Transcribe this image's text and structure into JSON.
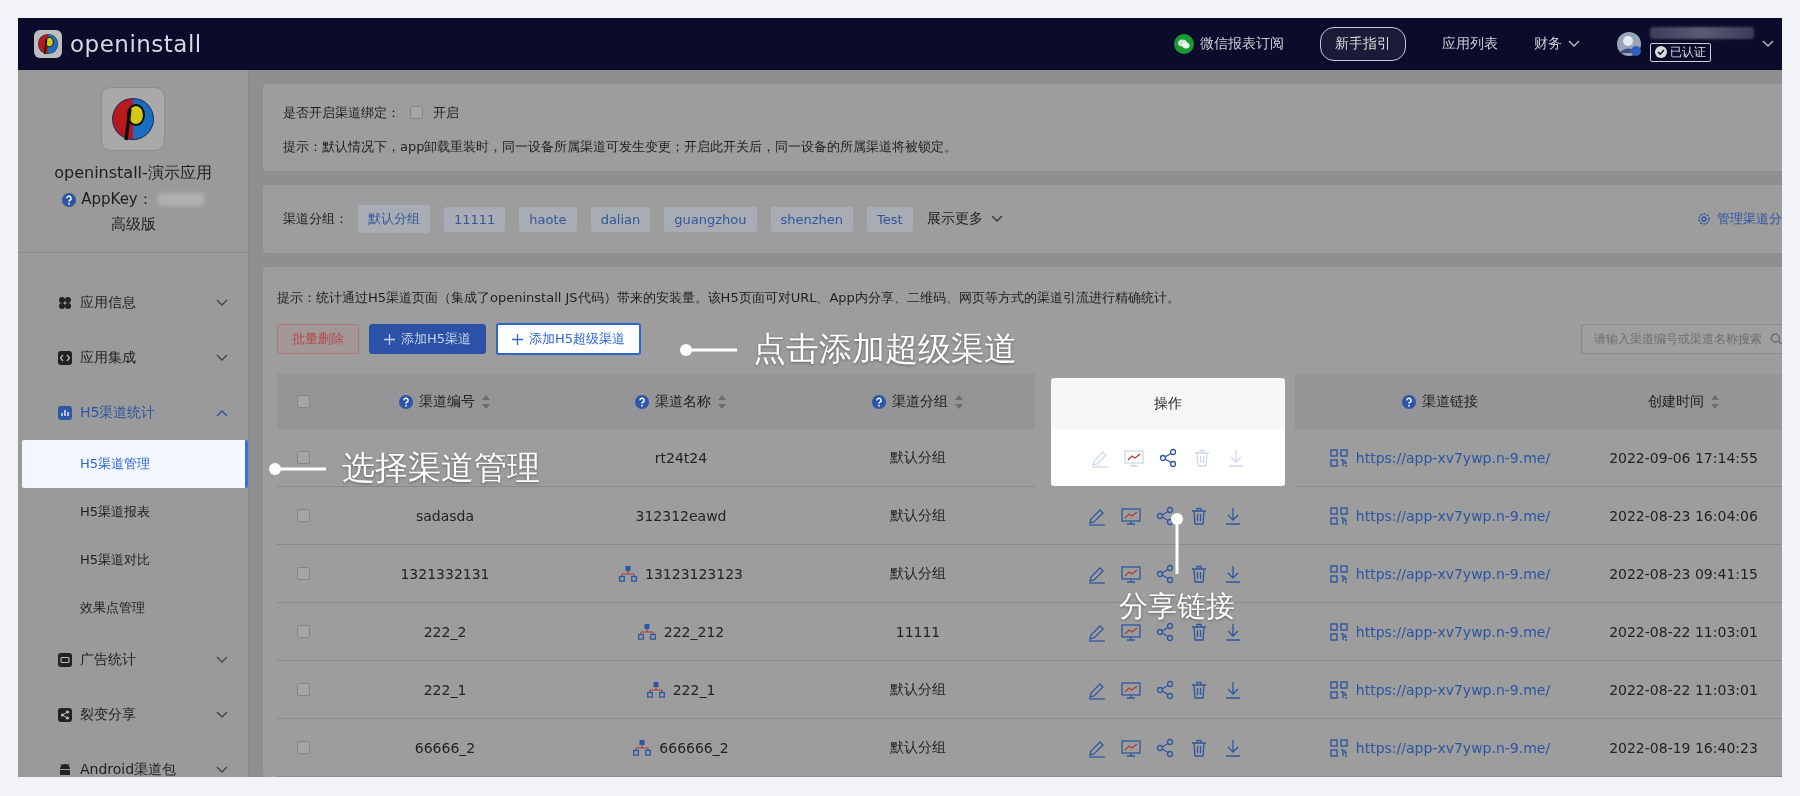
{
  "header": {
    "brand": "openinstall",
    "nav": [
      {
        "kind": "wechat",
        "label": "微信报表订阅"
      },
      {
        "kind": "guide",
        "label": "新手指引"
      },
      {
        "kind": "link",
        "label": "应用列表"
      },
      {
        "kind": "dropdown",
        "label": "财务"
      }
    ],
    "user": {
      "badge": "已认证"
    }
  },
  "sidebar": {
    "app_name": "openinstall-演示应用",
    "appkey_label": "AppKey：",
    "edition": "高级版",
    "menu": [
      {
        "label": "应用信息",
        "expanded": false
      },
      {
        "label": "应用集成",
        "expanded": false
      },
      {
        "label": "H5渠道统计",
        "expanded": true,
        "children": [
          {
            "label": "H5渠道管理",
            "selected": true
          },
          {
            "label": "H5渠道报表",
            "selected": false
          },
          {
            "label": "H5渠道对比",
            "selected": false
          },
          {
            "label": "效果点管理",
            "selected": false
          }
        ]
      },
      {
        "label": "广告统计",
        "expanded": false
      },
      {
        "label": "裂变分享",
        "expanded": false
      },
      {
        "label": "Android渠道包",
        "expanded": false
      }
    ]
  },
  "binding": {
    "label": "是否开启渠道绑定：",
    "checked": false,
    "option": "开启",
    "tip": "提示：默认情况下，app卸载重装时，同一设备所属渠道可发生变更；开启此开关后，同一设备的所属渠道将被锁定。"
  },
  "groups": {
    "label": "渠道分组：",
    "tags": [
      "默认分组",
      "11111",
      "haote",
      "dalian",
      "guangzhou",
      "shenzhen",
      "Test"
    ],
    "more": "展示更多",
    "manage": "管理渠道分"
  },
  "channels": {
    "tip": "提示：统计通过H5渠道页面（集成了openinstall JS代码）带来的安装量。该H5页面可对URL、App内分享、二维码、网页等方式的渠道引流进行精确统计。",
    "buttons": [
      {
        "kind": "danger",
        "label": "批量删除",
        "highlighted": false
      },
      {
        "kind": "primary",
        "label": "添加H5渠道",
        "highlighted": false
      },
      {
        "kind": "outline",
        "label": "添加H5超级渠道",
        "highlighted": true
      }
    ],
    "search": {
      "placeholder": "请输入渠道编号或渠道名称搜索"
    },
    "select_all": false,
    "columns": [
      {
        "kind": "text",
        "label": "渠道编号",
        "help": true,
        "sortable": true,
        "highlighted": false
      },
      {
        "kind": "name",
        "label": "渠道名称",
        "help": true,
        "sortable": true,
        "highlighted": false
      },
      {
        "kind": "text",
        "label": "渠道分组",
        "help": true,
        "sortable": true,
        "highlighted": false
      },
      {
        "kind": "actions",
        "label": "操作",
        "help": false,
        "sortable": false,
        "highlighted": true
      },
      {
        "kind": "link",
        "label": "渠道链接",
        "help": true,
        "sortable": false,
        "highlighted": false
      },
      {
        "kind": "text",
        "label": "创建时间",
        "help": false,
        "sortable": true,
        "highlighted": false
      }
    ],
    "rows": [
      {
        "checked": false,
        "highlighted": true,
        "super": false,
        "cells": [
          "",
          "rt24t24",
          "默认分组",
          "",
          "https://app-xv7ywp.n-9.me/",
          "2022-09-06 17:14:55"
        ]
      },
      {
        "checked": false,
        "highlighted": false,
        "super": false,
        "cells": [
          "sadasda",
          "312312eawd",
          "默认分组",
          "",
          "https://app-xv7ywp.n-9.me/",
          "2022-08-23 16:04:06"
        ]
      },
      {
        "checked": false,
        "highlighted": false,
        "super": true,
        "cells": [
          "1321332131",
          "13123123123",
          "默认分组",
          "",
          "https://app-xv7ywp.n-9.me/",
          "2022-08-23 09:41:15"
        ]
      },
      {
        "checked": false,
        "highlighted": false,
        "super": true,
        "cells": [
          "222_2",
          "222_212",
          "11111",
          "",
          "https://app-xv7ywp.n-9.me/",
          "2022-08-22 11:03:01"
        ]
      },
      {
        "checked": false,
        "highlighted": false,
        "super": true,
        "cells": [
          "222_1",
          "222_1",
          "默认分组",
          "",
          "https://app-xv7ywp.n-9.me/",
          "2022-08-22 11:03:01"
        ]
      },
      {
        "checked": false,
        "highlighted": false,
        "super": true,
        "cells": [
          "66666_2",
          "666666_2",
          "默认分组",
          "",
          "https://app-xv7ywp.n-9.me/",
          "2022-08-19 16:40:23"
        ]
      }
    ]
  },
  "annotations": [
    {
      "kind": "left",
      "text": "点击添加超级渠道"
    },
    {
      "kind": "left",
      "text": "选择渠道管理"
    },
    {
      "kind": "up",
      "text": "分享链接"
    }
  ]
}
